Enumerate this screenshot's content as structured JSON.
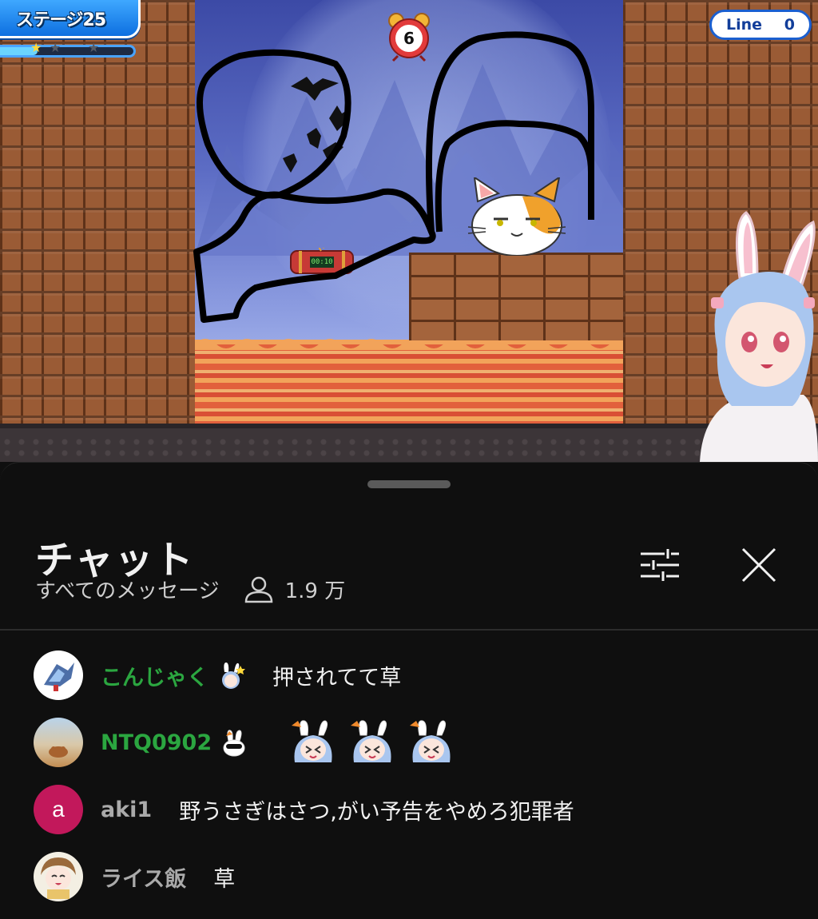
{
  "game": {
    "stage_label": "ステージ25",
    "stage_progress": 0.28,
    "stars_earned": 1,
    "stars_total": 3,
    "line_label": "Line",
    "line_count": "0",
    "timer_value": "6",
    "bomb_timer": "00:10"
  },
  "chat": {
    "title": "チャット",
    "filter_label": "すべてのメッセージ",
    "viewer_count": "1.9 万",
    "messages": [
      {
        "author": "こんじゃく",
        "text": "押されてて草",
        "member": true,
        "avatar_letter": ""
      },
      {
        "author": "NTQ0902",
        "text": "",
        "member": true,
        "avatar_letter": "",
        "emote_count": 3
      },
      {
        "author": "aki1",
        "text": "野うさぎはさつ,がい予告をやめろ犯罪者",
        "member": false,
        "avatar_letter": "a"
      },
      {
        "author": "ライス飯",
        "text": "草",
        "member": false,
        "avatar_letter": ""
      }
    ]
  },
  "colors": {
    "member_name": "#2ba640",
    "plain_name": "#aaaaaa",
    "panel_bg": "#0f0f0f",
    "stage_blue": "#0d6fe0",
    "aki_avatar": "#c2185b"
  },
  "icons": [
    "tune-icon",
    "close-icon",
    "person-icon",
    "alarm-clock-icon",
    "bomb-icon",
    "star-icon"
  ]
}
